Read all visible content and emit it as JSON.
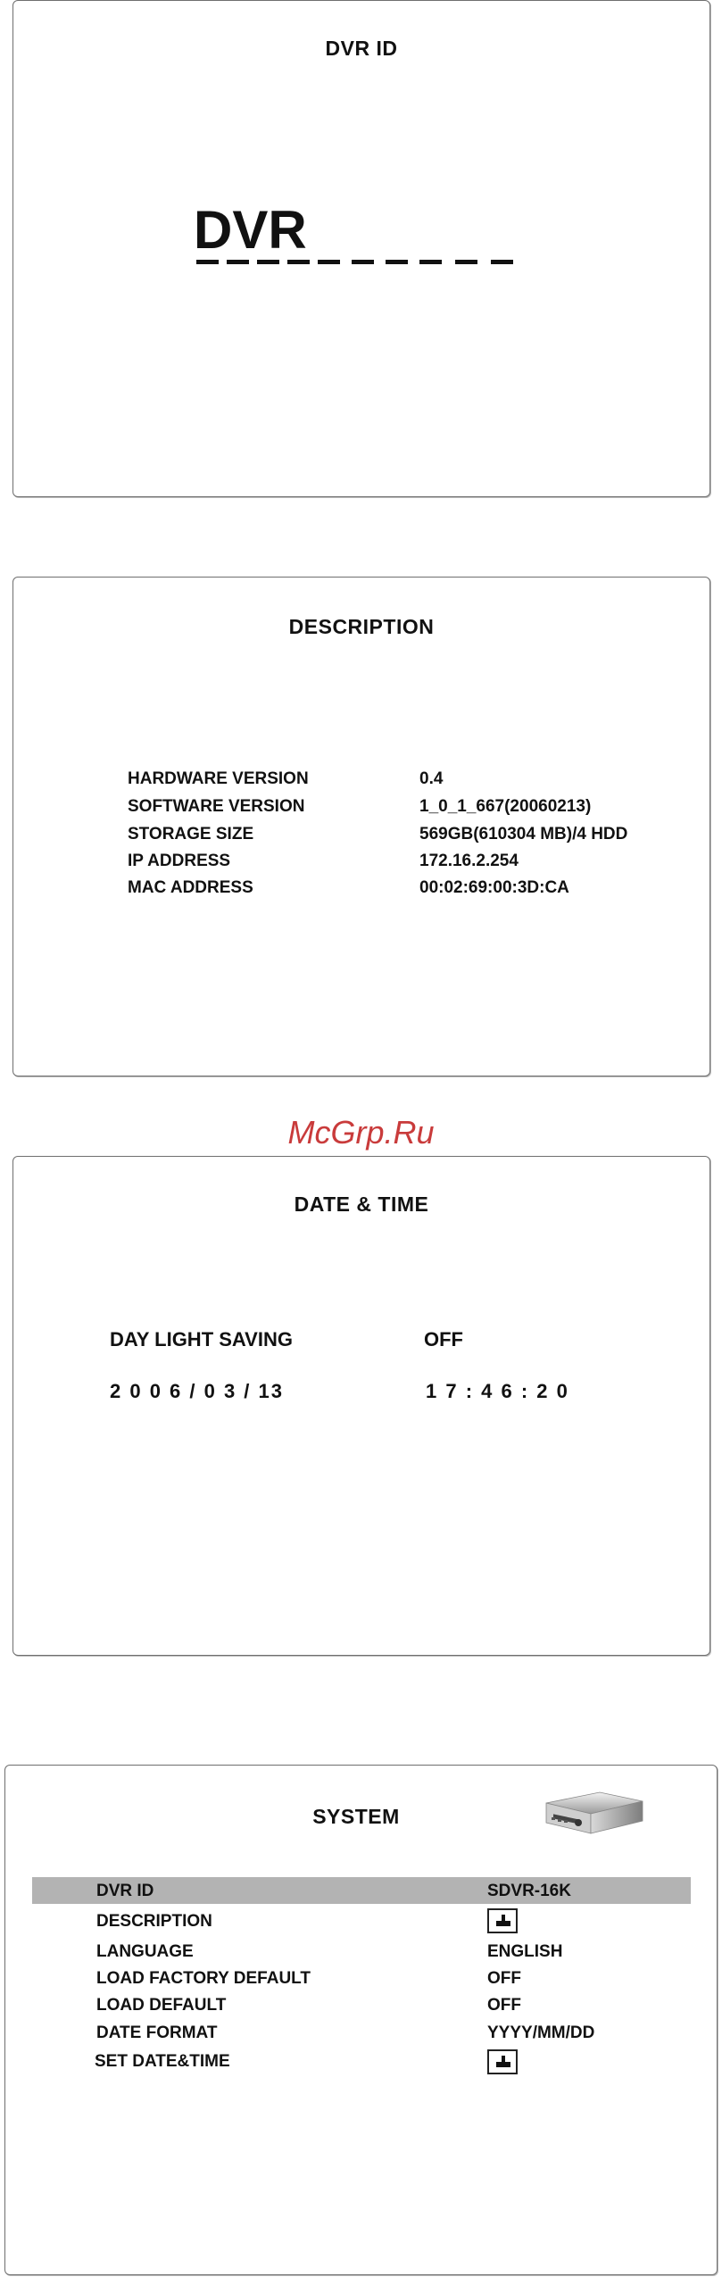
{
  "panel1": {
    "title": "DVR ID",
    "big_text": "DVR"
  },
  "panel2": {
    "title": "DESCRIPTION",
    "rows": [
      {
        "label": "HARDWARE VERSION",
        "value": "0.4"
      },
      {
        "label": "SOFTWARE VERSION",
        "value": "1_0_1_667(20060213)"
      },
      {
        "label": "STORAGE SIZE",
        "value": "569GB(610304 MB)/4 HDD"
      },
      {
        "label": "IP ADDRESS",
        "value": "172.16.2.254"
      },
      {
        "label": "MAC ADDRESS",
        "value": "00:02:69:00:3D:CA"
      }
    ]
  },
  "watermark": "McGrp.Ru",
  "panel3": {
    "title": "DATE & TIME",
    "dst_label": "DAY LIGHT SAVING",
    "dst_value": "OFF",
    "date": "2 0 0 6 / 0 3 / 13",
    "time": "1 7 : 4 6 : 2 0"
  },
  "panel4": {
    "title": "SYSTEM",
    "rows": [
      {
        "label": "DVR  ID",
        "value": "SDVR-16K"
      },
      {
        "label": "DESCRIPTION",
        "value": ""
      },
      {
        "label": "LANGUAGE",
        "value": "ENGLISH"
      },
      {
        "label": "LOAD FACTORY DEFAULT",
        "value": "OFF"
      },
      {
        "label": "LOAD DEFAULT",
        "value": "OFF"
      },
      {
        "label": "DATE FORMAT",
        "value": "YYYY/MM/DD"
      },
      {
        "label": "SET DATE&TIME",
        "value": ""
      }
    ],
    "icons": {
      "enter": "enter-icon",
      "device": "dvr-device-icon"
    },
    "highlight_color": "#b3b3b3"
  }
}
